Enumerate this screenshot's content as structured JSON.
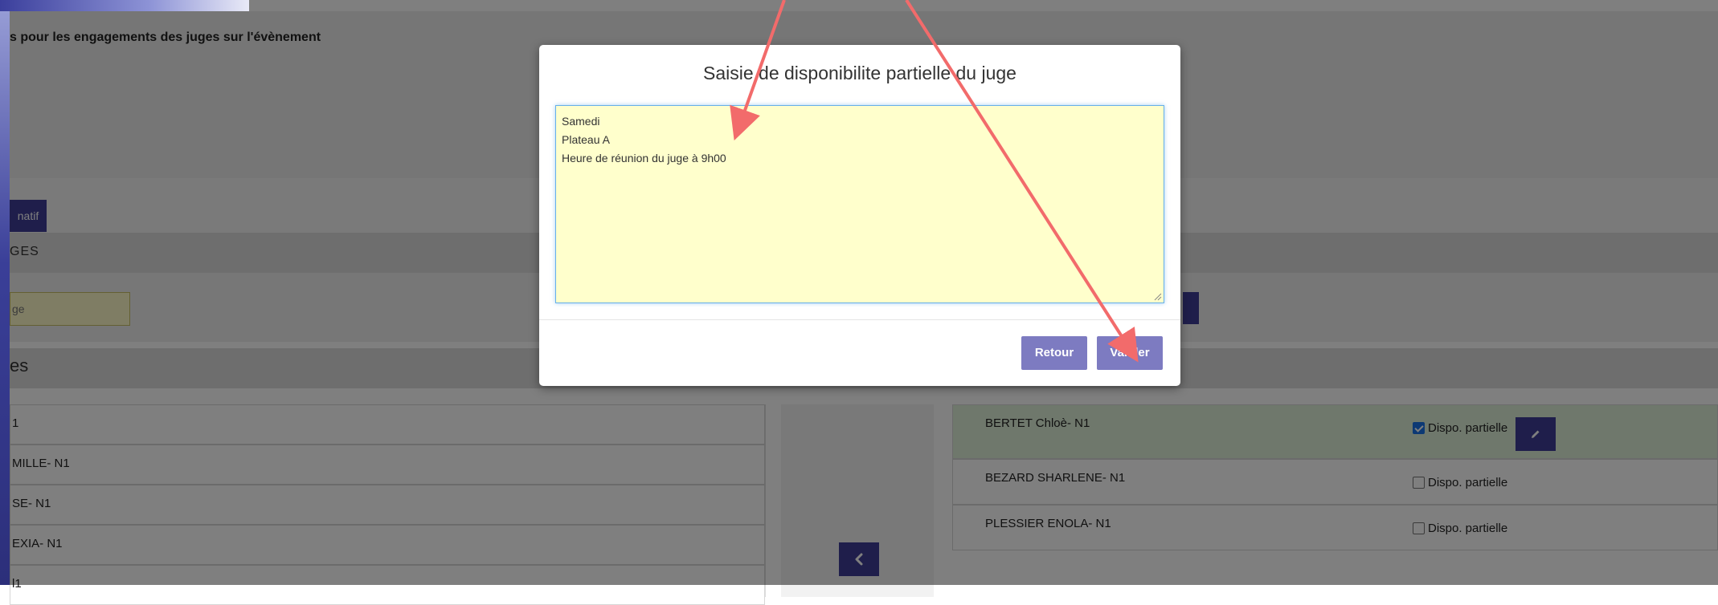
{
  "intro": {
    "text": "s pour les engagements des juges sur l'évènement"
  },
  "tabs": {
    "active_label": "natif"
  },
  "judges_section": {
    "title": "GES"
  },
  "search": {
    "placeholder": "ge"
  },
  "list_section": {
    "title": "es"
  },
  "available_judges": [
    "1",
    "MILLE- N1",
    "SE- N1",
    "EXIA- N1",
    "l1"
  ],
  "engaged_judges": [
    {
      "name": "BERTET Chloè- N1",
      "partial_label": "Dispo. partielle",
      "partial_checked": true
    },
    {
      "name": "BEZARD SHARLENE- N1",
      "partial_label": "Dispo. partielle",
      "partial_checked": false
    },
    {
      "name": "PLESSIER ENOLA- N1",
      "partial_label": "Dispo. partielle",
      "partial_checked": false
    }
  ],
  "modal": {
    "title": "Saisie de disponibilite partielle du juge",
    "textarea_lines": [
      "Samedi",
      "Plateau A",
      "Heure de réunion du juge à 9h00"
    ],
    "retour_label": "Retour",
    "valider_label": "Valider"
  },
  "colors": {
    "accent": "#3e3d97",
    "modal_button": "#7d7bc1",
    "annotation_arrow": "#f26b6b",
    "textarea_bg": "#ffffcc",
    "selected_row": "#dff0d8"
  },
  "icons": {
    "move_left": "chevron-left-icon",
    "edit": "pencil-icon"
  }
}
